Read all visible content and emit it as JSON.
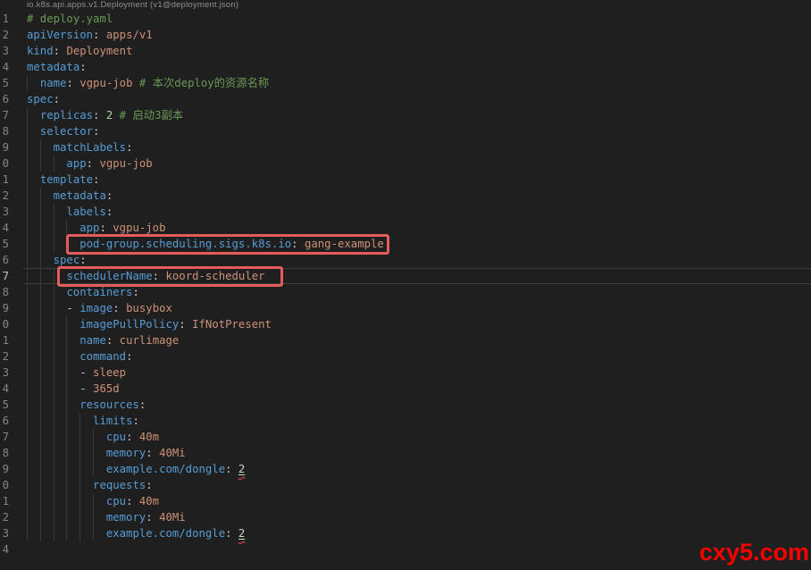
{
  "header": {
    "schema_label": "io.k8s.api.apps.v1.Deployment (v1@deployment.json)"
  },
  "watermark": {
    "text": "cxy5.com",
    "color": "#f60000"
  },
  "colors": {
    "background": "#1f1f1f",
    "key": "#569cd6",
    "value": "#ce9178",
    "comment": "#6a9955",
    "punctuation": "#cccccc",
    "number": "#b5cea8",
    "line_number": "#858585",
    "line_number_active": "#c6c6c6",
    "indent_guide": "#373737",
    "annotation_box_red": "#e45c5c",
    "current_line_border": "#3d3d3d",
    "error_squiggle": "#f14c4c"
  },
  "code": {
    "language": "yaml",
    "file_comment": "deploy.yaml",
    "lines": [
      {
        "n": "1",
        "indent": 0,
        "segs": [
          [
            "comment",
            "# deploy.yaml"
          ]
        ]
      },
      {
        "n": "2",
        "indent": 0,
        "segs": [
          [
            "key",
            "apiVersion"
          ],
          [
            "punc",
            ": "
          ],
          [
            "value",
            "apps/v1"
          ]
        ]
      },
      {
        "n": "3",
        "indent": 0,
        "segs": [
          [
            "key",
            "kind"
          ],
          [
            "punc",
            ": "
          ],
          [
            "value",
            "Deployment"
          ]
        ]
      },
      {
        "n": "4",
        "indent": 0,
        "segs": [
          [
            "key",
            "metadata"
          ],
          [
            "punc",
            ":"
          ]
        ]
      },
      {
        "n": "5",
        "indent": 2,
        "segs": [
          [
            "key",
            "name"
          ],
          [
            "punc",
            ": "
          ],
          [
            "value",
            "vgpu-job "
          ],
          [
            "comment",
            "# 本次deploy的资源名称"
          ]
        ]
      },
      {
        "n": "6",
        "indent": 0,
        "segs": [
          [
            "key",
            "spec"
          ],
          [
            "punc",
            ":"
          ]
        ]
      },
      {
        "n": "7",
        "indent": 2,
        "segs": [
          [
            "key",
            "replicas"
          ],
          [
            "punc",
            ": "
          ],
          [
            "number",
            "2 "
          ],
          [
            "comment",
            "# 启动3副本"
          ]
        ]
      },
      {
        "n": "8",
        "indent": 2,
        "segs": [
          [
            "key",
            "selector"
          ],
          [
            "punc",
            ":"
          ]
        ]
      },
      {
        "n": "9",
        "indent": 4,
        "segs": [
          [
            "key",
            "matchLabels"
          ],
          [
            "punc",
            ":"
          ]
        ]
      },
      {
        "n": "0",
        "indent": 6,
        "segs": [
          [
            "key",
            "app"
          ],
          [
            "punc",
            ": "
          ],
          [
            "value",
            "vgpu-job"
          ]
        ]
      },
      {
        "n": "1",
        "indent": 2,
        "segs": [
          [
            "key",
            "template"
          ],
          [
            "punc",
            ":"
          ]
        ]
      },
      {
        "n": "2",
        "indent": 4,
        "segs": [
          [
            "key",
            "metadata"
          ],
          [
            "punc",
            ":"
          ]
        ]
      },
      {
        "n": "3",
        "indent": 6,
        "segs": [
          [
            "key",
            "labels"
          ],
          [
            "punc",
            ":"
          ]
        ]
      },
      {
        "n": "4",
        "indent": 8,
        "segs": [
          [
            "key",
            "app"
          ],
          [
            "punc",
            ": "
          ],
          [
            "value",
            "vgpu-job"
          ]
        ]
      },
      {
        "n": "5",
        "indent": 8,
        "segs": [
          [
            "key",
            "pod-group.scheduling.sigs.k8s.io"
          ],
          [
            "punc",
            ": "
          ],
          [
            "value",
            "gang-example"
          ]
        ],
        "box": {
          "left_ch": 6,
          "width_ch": 48.8
        }
      },
      {
        "n": "6",
        "indent": 4,
        "segs": [
          [
            "key",
            "spec"
          ],
          [
            "punc",
            ":"
          ]
        ]
      },
      {
        "n": "7",
        "indent": 6,
        "segs": [
          [
            "key",
            "schedulerName"
          ],
          [
            "punc",
            ": "
          ],
          [
            "value",
            "koord-scheduler"
          ]
        ],
        "current": true,
        "box": {
          "left_ch": 4.6,
          "width_ch": 34.2
        }
      },
      {
        "n": "8",
        "indent": 6,
        "segs": [
          [
            "key",
            "containers"
          ],
          [
            "punc",
            ":"
          ]
        ]
      },
      {
        "n": "9",
        "indent": 6,
        "segs": [
          [
            "punc",
            "- "
          ],
          [
            "key",
            "image"
          ],
          [
            "punc",
            ": "
          ],
          [
            "value",
            "busybox"
          ]
        ]
      },
      {
        "n": "0",
        "indent": 8,
        "segs": [
          [
            "key",
            "imagePullPolicy"
          ],
          [
            "punc",
            ": "
          ],
          [
            "value",
            "IfNotPresent"
          ]
        ]
      },
      {
        "n": "1",
        "indent": 8,
        "segs": [
          [
            "key",
            "name"
          ],
          [
            "punc",
            ": "
          ],
          [
            "value",
            "curlimage"
          ]
        ]
      },
      {
        "n": "2",
        "indent": 8,
        "segs": [
          [
            "key",
            "command"
          ],
          [
            "punc",
            ":"
          ]
        ]
      },
      {
        "n": "3",
        "indent": 8,
        "segs": [
          [
            "punc",
            "- "
          ],
          [
            "value",
            "sleep"
          ]
        ]
      },
      {
        "n": "4",
        "indent": 8,
        "segs": [
          [
            "punc",
            "- "
          ],
          [
            "value",
            "365d"
          ]
        ]
      },
      {
        "n": "5",
        "indent": 8,
        "segs": [
          [
            "key",
            "resources"
          ],
          [
            "punc",
            ":"
          ]
        ]
      },
      {
        "n": "6",
        "indent": 10,
        "segs": [
          [
            "key",
            "limits"
          ],
          [
            "punc",
            ":"
          ]
        ]
      },
      {
        "n": "7",
        "indent": 12,
        "segs": [
          [
            "key",
            "cpu"
          ],
          [
            "punc",
            ": "
          ],
          [
            "value",
            "40m"
          ]
        ]
      },
      {
        "n": "8",
        "indent": 12,
        "segs": [
          [
            "key",
            "memory"
          ],
          [
            "punc",
            ": "
          ],
          [
            "value",
            "40Mi"
          ]
        ]
      },
      {
        "n": "9",
        "indent": 12,
        "segs": [
          [
            "key",
            "example.com/dongle"
          ],
          [
            "punc",
            ": "
          ],
          [
            "errnum",
            "2"
          ]
        ]
      },
      {
        "n": "0",
        "indent": 10,
        "segs": [
          [
            "key",
            "requests"
          ],
          [
            "punc",
            ":"
          ]
        ]
      },
      {
        "n": "1",
        "indent": 12,
        "segs": [
          [
            "key",
            "cpu"
          ],
          [
            "punc",
            ": "
          ],
          [
            "value",
            "40m"
          ]
        ]
      },
      {
        "n": "2",
        "indent": 12,
        "segs": [
          [
            "key",
            "memory"
          ],
          [
            "punc",
            ": "
          ],
          [
            "value",
            "40Mi"
          ]
        ]
      },
      {
        "n": "3",
        "indent": 12,
        "segs": [
          [
            "key",
            "example.com/dongle"
          ],
          [
            "punc",
            ": "
          ],
          [
            "errnum",
            "2"
          ]
        ]
      },
      {
        "n": "4",
        "indent": 0,
        "segs": []
      }
    ]
  }
}
